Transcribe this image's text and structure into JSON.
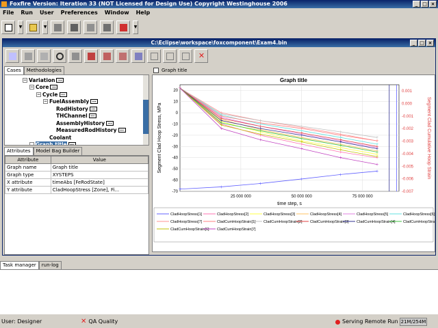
{
  "app": {
    "title": "Foxfire Version:  Iteration 33 (NOT Licensed for Design Use)    Copyright Westinghouse 2006"
  },
  "menu": [
    "File",
    "Run",
    "User",
    "Preferences",
    "Window",
    "Help"
  ],
  "editor": {
    "path": "C:\\Eclipse\\workspace\\foxcomponent\\Exam4.bin"
  },
  "left_tabs": [
    "Cases",
    "Methodologies"
  ],
  "tree": [
    {
      "label": "Variation",
      "indent": 0
    },
    {
      "label": "Core",
      "indent": 1
    },
    {
      "label": "Cycle",
      "indent": 2
    },
    {
      "label": "FuelAssembly",
      "indent": 3
    },
    {
      "label": "RodHistory",
      "indent": 4
    },
    {
      "label": "THChannel",
      "indent": 4
    },
    {
      "label": "AssemblyHistory",
      "indent": 4
    },
    {
      "label": "MeasuredRodHistory",
      "indent": 4
    },
    {
      "label": "Coolant",
      "indent": 3
    },
    {
      "label": "Graph title",
      "indent": 1
    }
  ],
  "attr_tabs": [
    "Attributes",
    "Model Bag Builder"
  ],
  "attributes": {
    "headers": [
      "Attribute",
      "Value"
    ],
    "rows": [
      [
        "Graph name",
        "Graph title"
      ],
      [
        "Graph type",
        "XYSTEPS"
      ],
      [
        "X attribute",
        "timeAbs [FeRodState]"
      ],
      [
        "Y attribute",
        "CladHoopStress [Zone], Fi..."
      ]
    ]
  },
  "graph_tab": "Graph title",
  "chart_data": {
    "type": "line",
    "title": "Graph title",
    "xlabel": "time step, s",
    "ylabel": "Segment Clad Hoop Stress, MPa",
    "y2label": "Segment Clad Cumulative Hoop Strain",
    "xlim": [
      0,
      90000000
    ],
    "ylim": [
      -70,
      25
    ],
    "y2lim": [
      -0.007,
      0.0015
    ],
    "xticks": [
      "25 000 000",
      "50 000 000",
      "75 000 000"
    ],
    "yticks": [
      "20",
      "10",
      "0",
      "-10",
      "-20",
      "-30",
      "-40",
      "-50",
      "-60",
      "-70"
    ],
    "y2ticks": [
      "0.001",
      "0.000",
      "-0.001",
      "-0.002",
      "-0.003",
      "-0.004",
      "-0.005",
      "-0.006",
      "-0.007"
    ],
    "x": [
      0,
      17000000,
      33000000,
      50000000,
      66000000,
      81000000
    ],
    "series": [
      {
        "name": "CladHoopStress[1]",
        "color": "#6060ff",
        "values": [
          -68,
          -66,
          -63,
          -59,
          -55,
          -52
        ]
      },
      {
        "name": "CladHoopStress[2]",
        "color": "#ff70b0",
        "values": [
          22,
          -10,
          -20,
          -28,
          -35,
          -40
        ]
      },
      {
        "name": "CladHoopStress[3]",
        "color": "#ffff40",
        "values": [
          22,
          -8,
          -17,
          -25,
          -31,
          -37
        ]
      },
      {
        "name": "CladHoopStress[4]",
        "color": "#ffc060",
        "values": [
          22,
          -6,
          -15,
          -22,
          -28,
          -34
        ]
      },
      {
        "name": "CladHoopStress[5]",
        "color": "#e080e0",
        "values": [
          22,
          -4,
          -12,
          -19,
          -25,
          -31
        ]
      },
      {
        "name": "CladHoopStress[6]",
        "color": "#60e0e0",
        "values": [
          22,
          -2,
          -10,
          -16,
          -22,
          -28
        ]
      },
      {
        "name": "CladHoopStress[7]",
        "color": "#ff9090",
        "values": [
          22,
          0,
          -7,
          -13,
          -19,
          -25
        ]
      },
      {
        "name": "CladCumHoopStrain[1]",
        "color": "#ff8080",
        "values": [
          22,
          -3,
          -9,
          -14,
          -20,
          -25
        ]
      },
      {
        "name": "CladCumHoopStrain[2]",
        "color": "#c0c0c0",
        "values": [
          22,
          -1,
          -7,
          -12,
          -17,
          -22
        ]
      },
      {
        "name": "CladCumHoopStrain[3]",
        "color": "#e04040",
        "values": [
          22,
          -5,
          -12,
          -18,
          -24,
          -30
        ]
      },
      {
        "name": "CladCumHoopStrain[4]",
        "color": "#303090",
        "values": [
          22,
          -7,
          -14,
          -20,
          -26,
          -32
        ]
      },
      {
        "name": "CladCumHoopStrain[5]",
        "color": "#40c040",
        "values": [
          22,
          -9,
          -16,
          -23,
          -29,
          -35
        ]
      },
      {
        "name": "CladCumHoopStrain[6]",
        "color": "#c0c000",
        "values": [
          22,
          -11,
          -19,
          -26,
          -33,
          -39
        ]
      },
      {
        "name": "CladCumHoopStrain[7]",
        "color": "#c040c0",
        "values": [
          22,
          -14,
          -24,
          -32,
          -40,
          -46
        ]
      }
    ]
  },
  "bottom_tabs": [
    "Task manager",
    "run-log"
  ],
  "status": {
    "user": "User: Designer",
    "qa": "QA Quality",
    "serving": "Serving Remote Run",
    "memory": "21M/254M"
  },
  "colors": {
    "title_bar": "#0a246a",
    "accent_red": "#e02020"
  }
}
